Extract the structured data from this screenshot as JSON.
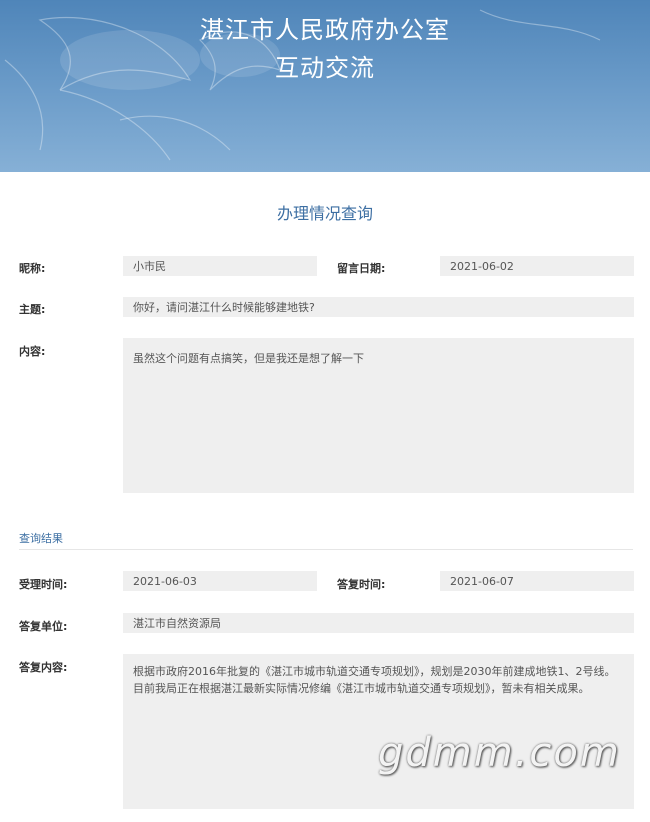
{
  "header": {
    "title_line1": "湛江市人民政府办公室",
    "title_line2": "互动交流"
  },
  "page_title": "办理情况查询",
  "form": {
    "nickname_label": "昵称:",
    "nickname_value": "小市民",
    "message_date_label": "留言日期:",
    "message_date_value": "2021-06-02",
    "subject_label": "主题:",
    "subject_value": "你好，请问湛江什么时候能够建地铁?",
    "content_label": "内容:",
    "content_value": "虽然这个问题有点搞笑，但是我还是想了解一下"
  },
  "result_section": {
    "title": "查询结果",
    "accept_time_label": "受理时间:",
    "accept_time_value": "2021-06-03",
    "reply_time_label": "答复时间:",
    "reply_time_value": "2021-06-07",
    "reply_unit_label": "答复单位:",
    "reply_unit_value": "湛江市自然资源局",
    "reply_content_label": "答复内容:",
    "reply_content_value": "根据市政府2016年批复的《湛江市城市轨道交通专项规划》，规划是2030年前建成地铁1、2号线。目前我局正在根据湛江最新实际情况修编《湛江市城市轨道交通专项规划》，暂未有相关成果。"
  },
  "watermark": "gdmm.com",
  "colors": {
    "banner": "#4f85b9",
    "heading": "#3d6fa3",
    "field_bg": "#efefef"
  }
}
